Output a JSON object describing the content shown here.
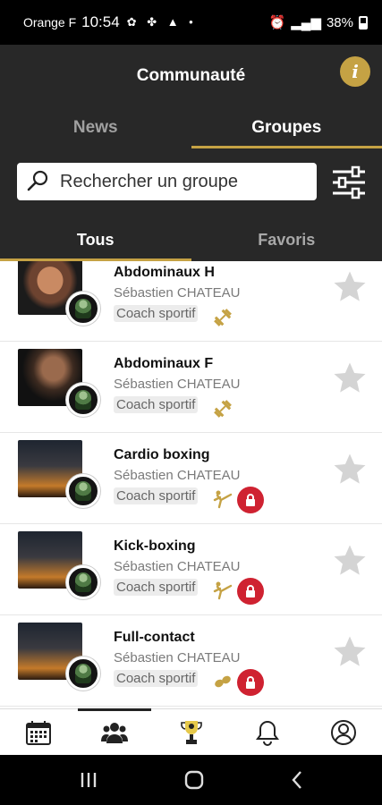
{
  "status_bar": {
    "carrier": "Orange F",
    "time": "10:54",
    "battery": "38%"
  },
  "header": {
    "title": "Communauté",
    "info_label": "i"
  },
  "top_tabs": [
    {
      "label": "News",
      "active": false
    },
    {
      "label": "Groupes",
      "active": true
    }
  ],
  "search": {
    "placeholder": "Rechercher un groupe"
  },
  "sub_tabs": [
    {
      "label": "Tous",
      "active": true
    },
    {
      "label": "Favoris",
      "active": false
    }
  ],
  "groups": [
    {
      "name": "Abdominaux H",
      "coach": "Sébastien CHATEAU",
      "tag": "Coach sportif",
      "sport_icon": "dumbbell-icon",
      "locked": false
    },
    {
      "name": "Abdominaux F",
      "coach": "Sébastien CHATEAU",
      "tag": "Coach sportif",
      "sport_icon": "dumbbell-icon",
      "locked": false
    },
    {
      "name": "Cardio boxing",
      "coach": "Sébastien CHATEAU",
      "tag": "Coach sportif",
      "sport_icon": "kick-icon",
      "locked": true
    },
    {
      "name": "Kick-boxing",
      "coach": "Sébastien CHATEAU",
      "tag": "Coach sportif",
      "sport_icon": "kick-icon",
      "locked": true
    },
    {
      "name": "Full-contact",
      "coach": "Sébastien CHATEAU",
      "tag": "Coach sportif",
      "sport_icon": "boxing-gloves-icon",
      "locked": true
    }
  ],
  "bottom_nav": [
    {
      "icon": "calendar-icon",
      "active": false
    },
    {
      "icon": "community-icon",
      "active": true
    },
    {
      "icon": "trophy-icon",
      "active": false
    },
    {
      "icon": "bell-icon",
      "active": false
    },
    {
      "icon": "profile-icon",
      "active": false
    }
  ],
  "colors": {
    "accent": "#c5a244",
    "header_bg": "#282828",
    "lock": "#cf2231"
  }
}
